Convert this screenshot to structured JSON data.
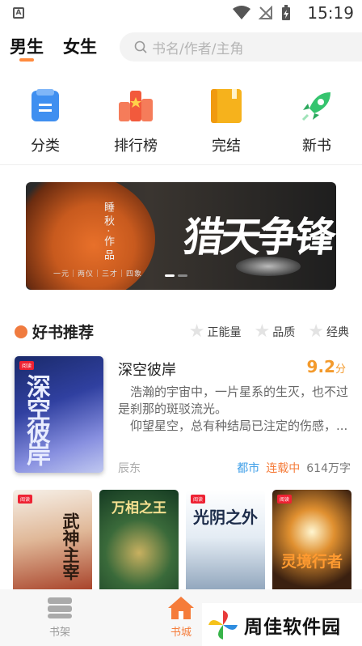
{
  "status_bar": {
    "time": "15:19",
    "app_badge": "A"
  },
  "header": {
    "tabs": [
      {
        "label": "男生",
        "active": true
      },
      {
        "label": "女生",
        "active": false
      }
    ],
    "search": {
      "placeholder": "书名/作者/主角"
    }
  },
  "categories": [
    {
      "label": "分类",
      "icon": "classify-icon",
      "color": "#3f8ff0"
    },
    {
      "label": "排行榜",
      "icon": "ranking-icon",
      "color": "#f25a3c"
    },
    {
      "label": "完结",
      "icon": "finished-book-icon",
      "color": "#f6b21c"
    },
    {
      "label": "新书",
      "icon": "rocket-icon",
      "color": "#35c46e"
    }
  ],
  "banner": {
    "title": "猎天争锋",
    "author_line": "睡秋·作品",
    "subtitle": "一元｜两仪｜三才｜四象"
  },
  "section": {
    "title": "好书推荐",
    "tags": [
      "正能量",
      "品质",
      "经典"
    ]
  },
  "featured": {
    "title": "深空彼岸",
    "cover_text": "深空彼岸",
    "score": "9.2",
    "score_unit": "分",
    "desc_line1": "浩瀚的宇宙中，一片星系的生灭，也不过是刹那的斑驳流光。",
    "desc_line2": "仰望星空，总有种结局已注定的伤感，...",
    "author": "辰东",
    "genre": "都市",
    "status": "连载中",
    "words": "614万字"
  },
  "covers": [
    {
      "title": "武神主宰"
    },
    {
      "title": "万相之王"
    },
    {
      "title": "光阴之外"
    },
    {
      "title": "灵境行者"
    }
  ],
  "bottom_nav": [
    {
      "label": "书架",
      "active": false
    },
    {
      "label": "书城",
      "active": true
    }
  ],
  "watermark": {
    "text": "周佳软件园"
  },
  "colors": {
    "accent": "#f57c3a",
    "score": "#f39a2c",
    "genre": "#3f9fe8"
  }
}
